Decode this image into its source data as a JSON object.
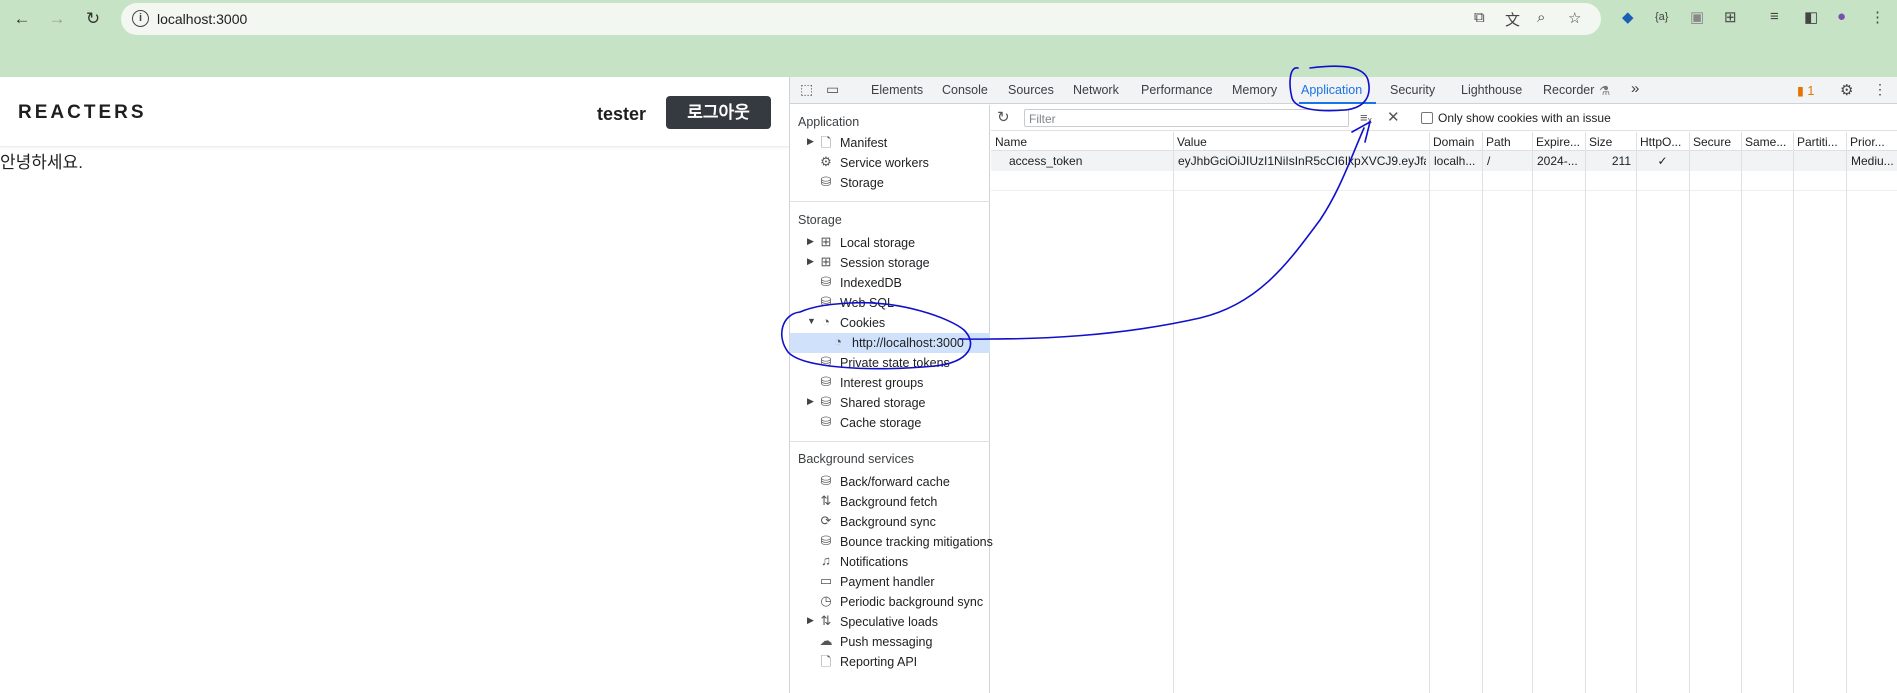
{
  "browser": {
    "url": "localhost:3000"
  },
  "site": {
    "logo": "REACTERS",
    "username": "tester",
    "logout_label": "로그아웃",
    "greeting": "안녕하세요."
  },
  "devtools": {
    "tabs": [
      "Elements",
      "Console",
      "Sources",
      "Network",
      "Performance",
      "Memory",
      "Application",
      "Security",
      "Lighthouse",
      "Recorder"
    ],
    "more_tabs": "»",
    "issues_count": "1",
    "sidebar": {
      "application_header": "Application",
      "application_items": [
        {
          "label": "Manifest",
          "icon": "file-icon"
        },
        {
          "label": "Service workers",
          "icon": "gears-icon"
        },
        {
          "label": "Storage",
          "icon": "database-icon"
        }
      ],
      "storage_header": "Storage",
      "storage_items": [
        {
          "label": "Local storage",
          "icon": "table-icon"
        },
        {
          "label": "Session storage",
          "icon": "table-icon"
        },
        {
          "label": "IndexedDB",
          "icon": "database-icon"
        },
        {
          "label": "Web SQL",
          "icon": "database-icon"
        },
        {
          "label": "Cookies",
          "icon": "cookie-icon"
        },
        {
          "label": "http://localhost:3000",
          "icon": "cookie-icon"
        },
        {
          "label": "Private state tokens",
          "icon": "database-icon"
        },
        {
          "label": "Interest groups",
          "icon": "database-icon"
        },
        {
          "label": "Shared storage",
          "icon": "database-icon"
        },
        {
          "label": "Cache storage",
          "icon": "database-icon"
        }
      ],
      "background_header": "Background services",
      "background_items": [
        {
          "label": "Back/forward cache",
          "icon": "database-icon"
        },
        {
          "label": "Background fetch",
          "icon": "arrows-icon"
        },
        {
          "label": "Background sync",
          "icon": "sync-icon"
        },
        {
          "label": "Bounce tracking mitigations",
          "icon": "database-icon"
        },
        {
          "label": "Notifications",
          "icon": "bell-icon"
        },
        {
          "label": "Payment handler",
          "icon": "card-icon"
        },
        {
          "label": "Periodic background sync",
          "icon": "clock-icon"
        },
        {
          "label": "Speculative loads",
          "icon": "arrows-icon"
        },
        {
          "label": "Push messaging",
          "icon": "cloud-icon"
        },
        {
          "label": "Reporting API",
          "icon": "file-icon"
        }
      ]
    },
    "cookies": {
      "filter_placeholder": "Filter",
      "only_issue_label": "Only show cookies with an issue",
      "columns": [
        "Name",
        "Value",
        "Domain",
        "Path",
        "Expire...",
        "Size",
        "HttpO...",
        "Secure",
        "Same...",
        "Partiti...",
        "Prior..."
      ],
      "rows": [
        {
          "name": "access_token",
          "value": "eyJhbGciOiJIUzI1NiIsInR5cCI6IkpXVCJ9.eyJfa...",
          "domain": "localh...",
          "path": "/",
          "expires": "2024-...",
          "size": "211",
          "httponly": "✓",
          "secure": "",
          "samesite": "",
          "partition": "",
          "priority": "Mediu..."
        }
      ]
    }
  },
  "colors": {
    "chrome_frame": "#c7e3c5",
    "annotation_ink": "#1010cc",
    "devtools_accent": "#1a73e8"
  }
}
